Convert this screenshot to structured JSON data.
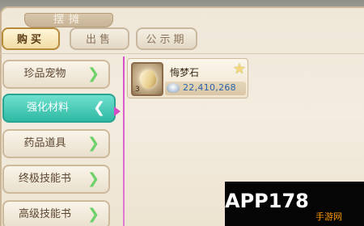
{
  "window": {
    "title": "摆摊"
  },
  "tabs": [
    {
      "label": "购买",
      "active": true
    },
    {
      "label": "出售",
      "active": false
    },
    {
      "label": "公示期",
      "active": false
    }
  ],
  "categories": [
    {
      "label": "珍品宠物",
      "active": false
    },
    {
      "label": "强化材料",
      "active": true
    },
    {
      "label": "药品道具",
      "active": false
    },
    {
      "label": "终极技能书",
      "active": false
    },
    {
      "label": "高级技能书",
      "active": false
    }
  ],
  "items": [
    {
      "name": "悔梦石",
      "quantity": "3",
      "price": "22,410,268",
      "icon": "dream-stone-icon",
      "currency_icon": "silver-ingot-icon",
      "favorite_icon": "star-icon"
    }
  ],
  "watermark": {
    "logo_main": "APP178",
    "logo_sub": "手游网"
  },
  "colors": {
    "active_category": "#2fb9a3",
    "divider": "#d74fca",
    "price": "#2a63a8",
    "chevron": "#6fd16a"
  }
}
